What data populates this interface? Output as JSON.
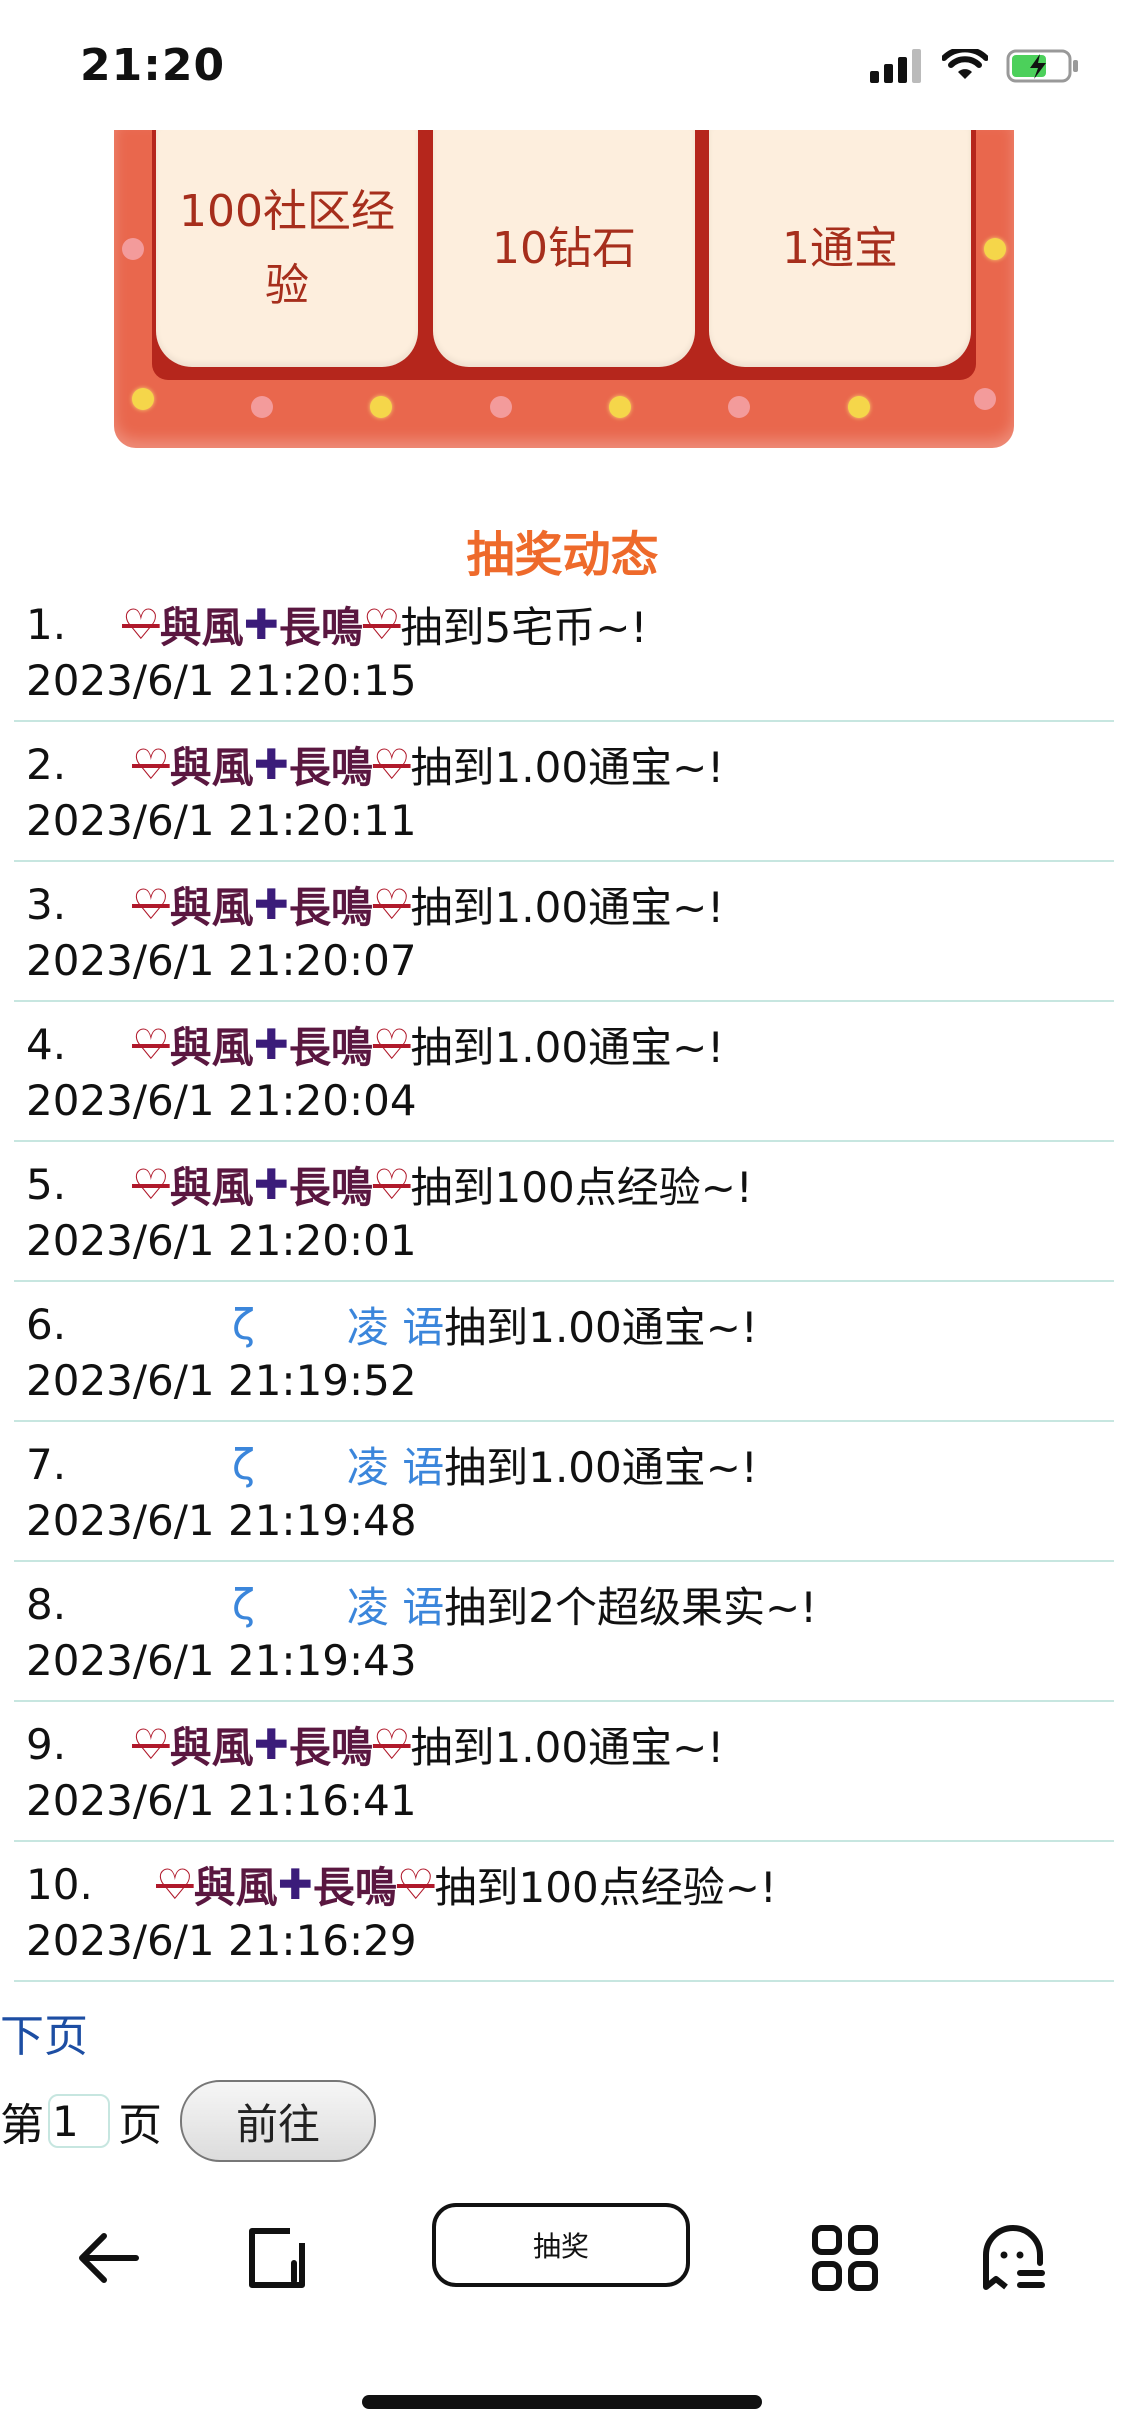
{
  "status_bar": {
    "time": "21:20"
  },
  "prizes": [
    {
      "label": "100社区经验"
    },
    {
      "label": "10钻石"
    },
    {
      "label": "1通宝"
    }
  ],
  "section": {
    "title": "抽奖动态"
  },
  "records": [
    {
      "num": "1.",
      "user_style": "purple",
      "user": {
        "a": "與風",
        "b": "長鳴"
      },
      "text": "抽到5宅币~!",
      "time": "2023/6/1 21:20:15"
    },
    {
      "num": "2.",
      "user_style": "purple",
      "user": {
        "a": "與風",
        "b": "長鳴"
      },
      "text": "抽到1.00通宝~!",
      "time": "2023/6/1 21:20:11"
    },
    {
      "num": "3.",
      "user_style": "purple",
      "user": {
        "a": "與風",
        "b": "長鳴"
      },
      "text": "抽到1.00通宝~!",
      "time": "2023/6/1 21:20:07"
    },
    {
      "num": "4.",
      "user_style": "purple",
      "user": {
        "a": "與風",
        "b": "長鳴"
      },
      "text": "抽到1.00通宝~!",
      "time": "2023/6/1 21:20:04"
    },
    {
      "num": "5.",
      "user_style": "purple",
      "user": {
        "a": "與風",
        "b": "長鳴"
      },
      "text": "抽到100点经验~!",
      "time": "2023/6/1 21:20:01"
    },
    {
      "num": "6.",
      "user_style": "blue",
      "user": {
        "a": "ζ",
        "b": "凌 语"
      },
      "text": "抽到1.00通宝~!",
      "time": "2023/6/1 21:19:52"
    },
    {
      "num": "7.",
      "user_style": "blue",
      "user": {
        "a": "ζ",
        "b": "凌 语"
      },
      "text": "抽到1.00通宝~!",
      "time": "2023/6/1 21:19:48"
    },
    {
      "num": "8.",
      "user_style": "blue",
      "user": {
        "a": "ζ",
        "b": "凌 语"
      },
      "text": "抽到2个超级果实~!",
      "time": "2023/6/1 21:19:43"
    },
    {
      "num": "9.",
      "user_style": "purple",
      "user": {
        "a": "與風",
        "b": "長鳴"
      },
      "text": "抽到1.00通宝~!",
      "time": "2023/6/1 21:16:41"
    },
    {
      "num": "10.",
      "user_style": "purple",
      "user": {
        "a": "與風",
        "b": "長鳴"
      },
      "text": "抽到100点经验~!",
      "time": "2023/6/1 21:16:29"
    }
  ],
  "pagination": {
    "next_label": "下页",
    "prefix": "第",
    "page_value": "1",
    "suffix": "页",
    "goto_label": "前往"
  },
  "bottom_nav": {
    "lottery_label": "抽奖",
    "icons": [
      "back-arrow-icon",
      "page-icon",
      "grid-icon",
      "ghost-icon"
    ]
  }
}
